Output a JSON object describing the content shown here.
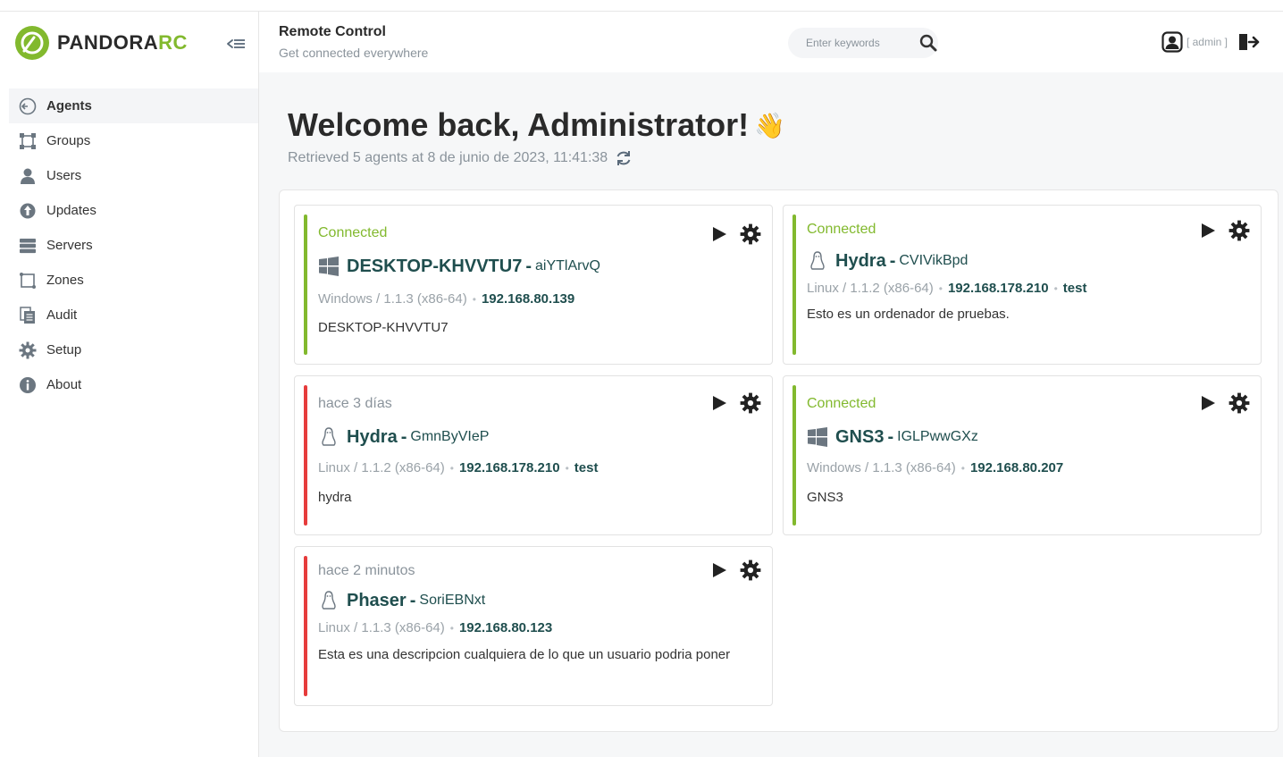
{
  "brand": {
    "name_main": "PANDORA",
    "name_accent": "RC",
    "accent_color": "#82b92e"
  },
  "header": {
    "title": "Remote Control",
    "subtitle": "Get connected everywhere",
    "search_placeholder": "Enter keywords",
    "user_label": "[ admin ]"
  },
  "sidebar": {
    "items": [
      {
        "label": "Agents",
        "icon": "agents-icon",
        "active": true
      },
      {
        "label": "Groups",
        "icon": "groups-icon"
      },
      {
        "label": "Users",
        "icon": "user-icon"
      },
      {
        "label": "Updates",
        "icon": "updates-icon"
      },
      {
        "label": "Servers",
        "icon": "servers-icon"
      },
      {
        "label": "Zones",
        "icon": "zones-icon"
      },
      {
        "label": "Audit",
        "icon": "audit-icon"
      },
      {
        "label": "Setup",
        "icon": "setup-gear-icon"
      },
      {
        "label": "About",
        "icon": "info-icon"
      }
    ]
  },
  "main": {
    "welcome": "Welcome back, Administrator!",
    "wave": "👋",
    "retrieved": "Retrieved 5 agents at 8 de junio de 2023, 11:41:38"
  },
  "colors": {
    "connected": "#82b92e",
    "disconnected": "#e63c3c"
  },
  "agents": [
    {
      "status": "Connected",
      "os_icon": "windows-icon",
      "name": "DESKTOP-KHVVTU7",
      "id": "aiYTlArvQ",
      "os": "Windows / 1.1.3 (x86-64)",
      "ip": "192.168.80.139",
      "group": "",
      "description": "DESKTOP-KHVVTU7"
    },
    {
      "status": "Connected",
      "os_icon": "linux-icon",
      "name": "Hydra",
      "id": "CVIVikBpd",
      "os": "Linux / 1.1.2 (x86-64)",
      "ip": "192.168.178.210",
      "group": "test",
      "description": "Esto es un ordenador de pruebas."
    },
    {
      "status": "hace 3 días",
      "os_icon": "linux-icon",
      "name": "Hydra",
      "id": "GmnByVIeP",
      "os": "Linux / 1.1.2 (x86-64)",
      "ip": "192.168.178.210",
      "group": "test",
      "description": "hydra"
    },
    {
      "status": "Connected",
      "os_icon": "windows-icon",
      "name": "GNS3",
      "id": "IGLPwwGXz",
      "os": "Windows / 1.1.3 (x86-64)",
      "ip": "192.168.80.207",
      "group": "",
      "description": "GNS3"
    },
    {
      "status": "hace 2 minutos",
      "os_icon": "linux-icon",
      "name": "Phaser",
      "id": "SoriEBNxt",
      "os": "Linux / 1.1.3 (x86-64)",
      "ip": "192.168.80.123",
      "group": "",
      "description": "Esta es una descripcion cualquiera de lo que un usuario podria poner"
    }
  ]
}
